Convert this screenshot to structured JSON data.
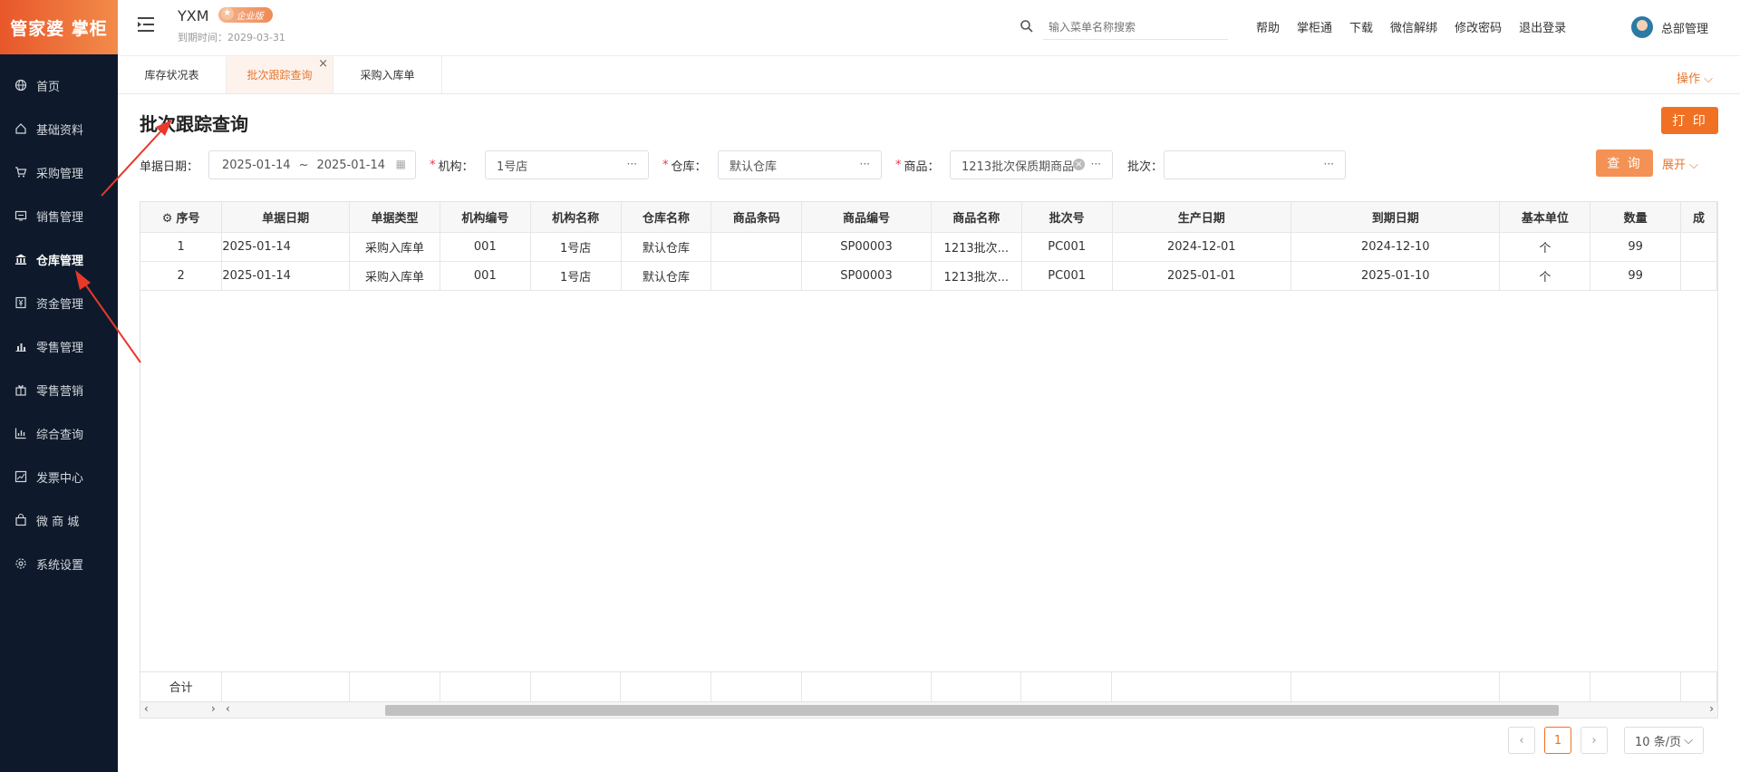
{
  "sidebar": {
    "logo": "管家婆 掌柜",
    "items": [
      {
        "label": "首页",
        "icon": "globe-icon"
      },
      {
        "label": "基础资料",
        "icon": "home-icon"
      },
      {
        "label": "采购管理",
        "icon": "cart-icon"
      },
      {
        "label": "销售管理",
        "icon": "monitor-icon"
      },
      {
        "label": "仓库管理",
        "icon": "bank-icon",
        "active": true
      },
      {
        "label": "资金管理",
        "icon": "money-icon"
      },
      {
        "label": "零售管理",
        "icon": "bar-chart-icon"
      },
      {
        "label": "零售营销",
        "icon": "gift-icon"
      },
      {
        "label": "综合查询",
        "icon": "stats-icon"
      },
      {
        "label": "发票中心",
        "icon": "trend-icon"
      },
      {
        "label": "微 商 城",
        "icon": "bag-icon"
      },
      {
        "label": "系统设置",
        "icon": "gear-icon"
      }
    ]
  },
  "header": {
    "brand": "YXM",
    "badge": "企业版",
    "expire": "到期时间：2029-03-31",
    "search_placeholder": "输入菜单名称搜索",
    "links": [
      "帮助",
      "掌柜通",
      "下载",
      "微信解绑",
      "修改密码",
      "退出登录"
    ],
    "username": "总部管理"
  },
  "tabs": [
    "库存状况表",
    "批次跟踪查询",
    "采购入库单"
  ],
  "active_tab": 1,
  "operation": "操作",
  "page": {
    "title": "批次跟踪查询",
    "print": "打 印",
    "query": "查 询",
    "expand": "展开"
  },
  "filters": {
    "date_label": "单据日期：",
    "date_from": "2025-01-14",
    "date_sep": "~",
    "date_to": "2025-01-14",
    "org_label": "机构：",
    "org_value": "1号店",
    "wh_label": "仓库：",
    "wh_value": "默认仓库",
    "goods_label": "商品：",
    "goods_value": "1213批次保质期商品",
    "batch_label": "批次：",
    "batch_value": ""
  },
  "table": {
    "columns": [
      "序号",
      "单据日期",
      "单据类型",
      "机构编号",
      "机构名称",
      "仓库名称",
      "商品条码",
      "商品编号",
      "商品名称",
      "批次号",
      "生产日期",
      "到期日期",
      "基本单位",
      "数量",
      "成"
    ],
    "rows": [
      [
        "1",
        "2025-01-14",
        "采购入库单",
        "001",
        "1号店",
        "默认仓库",
        "",
        "SP00003",
        "1213批次...",
        "PC001",
        "2024-12-01",
        "2024-12-10",
        "个",
        "99",
        ""
      ],
      [
        "2",
        "2025-01-14",
        "采购入库单",
        "001",
        "1号店",
        "默认仓库",
        "",
        "SP00003",
        "1213批次...",
        "PC001",
        "2025-01-01",
        "2025-01-10",
        "个",
        "99",
        ""
      ]
    ],
    "total_label": "合计"
  },
  "pagination": {
    "current": "1",
    "page_size": "10 条/页"
  }
}
